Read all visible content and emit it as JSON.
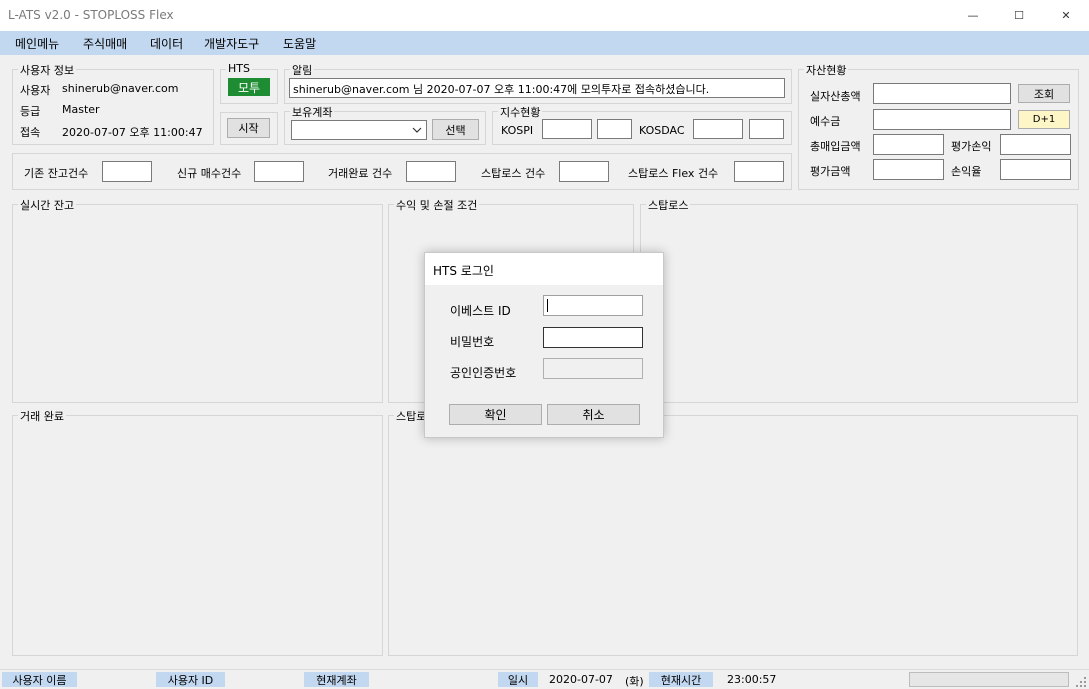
{
  "window": {
    "title": "L-ATS v2.0 - STOPLOSS Flex",
    "minimize": "—",
    "maximize": "☐",
    "close": "✕"
  },
  "menu": [
    "메인메뉴",
    "주식매매",
    "데이터",
    "개발자도구",
    "도움말"
  ],
  "user_info": {
    "title": "사용자 정보",
    "user_label": "사용자",
    "user_value": "shinerub@naver.com",
    "grade_label": "등급",
    "grade_value": "Master",
    "conn_label": "접속",
    "conn_value": "2020-07-07 오후 11:00:47"
  },
  "hts": {
    "title": "HTS",
    "badge": "모투",
    "badge_color": "#1e8c33",
    "start_button": "시작"
  },
  "alert": {
    "title": "알림",
    "message": "shinerub@naver.com 님 2020-07-07 오후 11:00:47에 모의투자로 접속하셨습니다."
  },
  "account": {
    "title": "보유계좌",
    "select_value": "",
    "select_button": "선택"
  },
  "index": {
    "title": "지수현황",
    "kospi_label": "KOSPI",
    "kosdac_label": "KOSDAC"
  },
  "assets": {
    "title": "자산현황",
    "total_label": "실자산총액",
    "query_button": "조회",
    "deposit_label": "예수금",
    "d1_button": "D+1",
    "d1_color": "#fff6c8",
    "buy_total_label": "총매입금액",
    "eval_pl_label": "평가손익",
    "eval_amount_label": "평가금액",
    "pl_rate_label": "손익율"
  },
  "counts": {
    "base_label": "기존 잔고건수",
    "new_buy_label": "신규 매수건수",
    "done_label": "거래완료 건수",
    "stoploss_label": "스탑로스 건수",
    "flex_label": "스탑로스 Flex 건수"
  },
  "panels": {
    "realtime": "실시간 잔고",
    "profit_loss": "수익 및 손절 조건",
    "stoploss_top": "스탑로스",
    "trade_done": "거래 완료",
    "stoploss_bottom": "스탑로"
  },
  "dialog": {
    "title": "HTS 로그인",
    "id_label": "이베스트 ID",
    "pw_label": "비밀번호",
    "cert_label": "공인인증번호",
    "ok_button": "확인",
    "cancel_button": "취소"
  },
  "statusbar": {
    "user_name_label": "사용자 이름",
    "user_id_label": "사용자 ID",
    "account_label": "현재계좌",
    "date_label": "일시",
    "date_value": "2020-07-07",
    "weekday": "(화)",
    "time_label": "현재시간",
    "time_value": "23:00:57"
  },
  "accent_color": "#c2d7f0"
}
